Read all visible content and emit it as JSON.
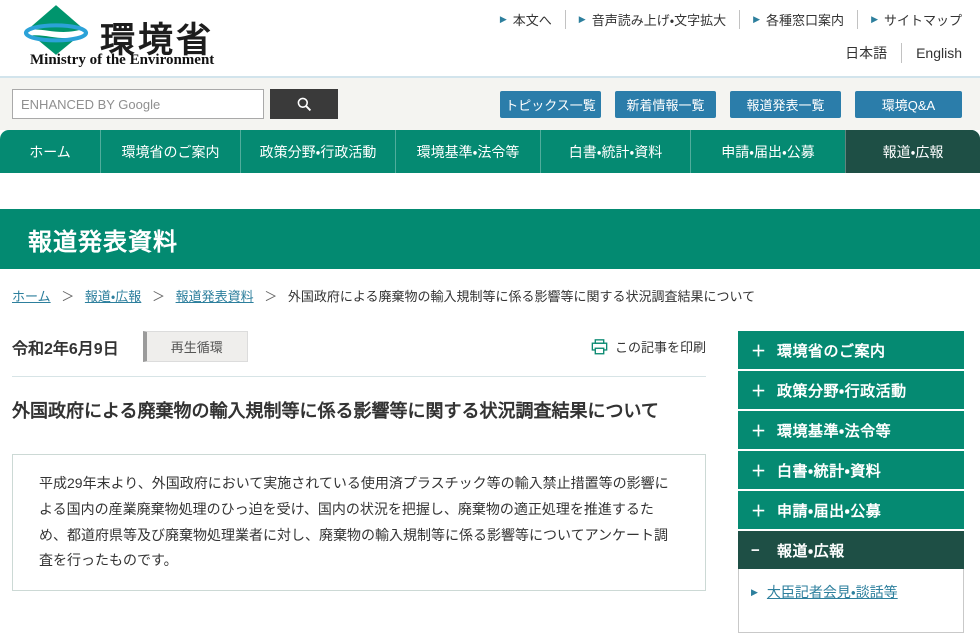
{
  "icons": {
    "utility_arrow": "▶",
    "sub_arrow": "▶",
    "expand": "＋",
    "collapse": "−"
  },
  "colors": {
    "teal_primary": "#038a71",
    "teal_dark_active": "#1e4f45",
    "button_blue": "#2b7daa",
    "link_blue": "#2d7f9d",
    "search_button_gray": "#3a3a3a"
  },
  "header": {
    "logo_title": "環境省",
    "logo_subtitle": "Ministry of the Environment",
    "utility_links": [
      "本文へ",
      "音声読み上げ・文字拡大",
      "各種窓口案内",
      "サイトマップ"
    ],
    "lang_jp": "日本語",
    "lang_en": "English"
  },
  "search": {
    "placeholder": "ENHANCED BY Google"
  },
  "quick_buttons": [
    "トピックス一覧",
    "新着情報一覧",
    "報道発表一覧",
    "環境Q&A"
  ],
  "nav": {
    "items": [
      {
        "label": "ホーム"
      },
      {
        "label": "環境省のご案内"
      },
      {
        "label": "政策分野・行政活動"
      },
      {
        "label": "環境基準・法令等"
      },
      {
        "label": "白書・統計・資料"
      },
      {
        "label": "申請・届出・公募"
      },
      {
        "label": "報道・広報"
      }
    ],
    "active_label": "報道・広報"
  },
  "page_band": {
    "title": "報道発表資料"
  },
  "breadcrumb": {
    "separator": "＞",
    "links": [
      "ホーム",
      "報道・広報",
      "報道発表資料"
    ],
    "current": "外国政府による廃棄物の輸入規制等に係る影響等に関する状況調査結果について"
  },
  "article": {
    "date": "令和2年6月9日",
    "category_badge": "再生循環",
    "print_label": "この記事を印刷",
    "title": "外国政府による廃棄物の輸入規制等に係る影響等に関する状況調査結果について",
    "summary": "平成29年末より、外国政府において実施されている使用済プラスチック等の輸入禁止措置等の影響による国内の産業廃棄物処理のひっ迫を受け、国内の状況を把握し、廃棄物の適正処理を推進するため、都道府県等及び廃棄物処理業者に対し、廃棄物の輸入規制等に係る影響等についてアンケート調査を行ったものです。"
  },
  "sidebar": {
    "items": [
      {
        "label": "環境省のご案内",
        "toggle": "＋"
      },
      {
        "label": "政策分野・行政活動",
        "toggle": "＋"
      },
      {
        "label": "環境基準・法令等",
        "toggle": "＋"
      },
      {
        "label": "白書・統計・資料",
        "toggle": "＋"
      },
      {
        "label": "申請・届出・公募",
        "toggle": "＋"
      },
      {
        "label": "報道・広報",
        "toggle": "−"
      }
    ],
    "sub_items": [
      {
        "label": "大臣記者会見・談話等"
      }
    ]
  }
}
